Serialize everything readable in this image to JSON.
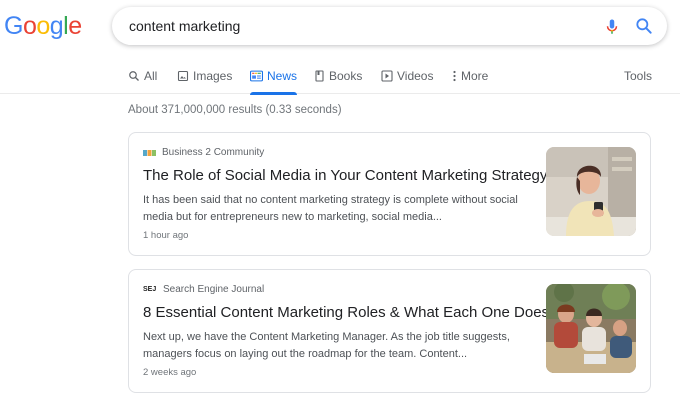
{
  "logo": {
    "letters": [
      "G",
      "o",
      "o",
      "g",
      "l",
      "e"
    ],
    "colors": [
      "#4285f4",
      "#ea4335",
      "#fbbc05",
      "#4285f4",
      "#34a853",
      "#ea4335"
    ]
  },
  "search": {
    "query": "content marketing",
    "mic_icon": "microphone-icon",
    "search_icon": "search-icon"
  },
  "tabs": [
    {
      "label": "All",
      "icon": "search-icon"
    },
    {
      "label": "Images",
      "icon": "image-icon"
    },
    {
      "label": "News",
      "icon": "news-icon",
      "active": true
    },
    {
      "label": "Books",
      "icon": "book-icon"
    },
    {
      "label": "Videos",
      "icon": "play-icon"
    },
    {
      "label": "More",
      "icon": "more-vert-icon"
    },
    {
      "label": "Tools"
    }
  ],
  "result_stats": "About 371,000,000 results (0.33 seconds)",
  "results": [
    {
      "source": "Business 2 Community",
      "title": "The Role of Social Media in Your Content Marketing Strategy",
      "snippet_line1": "It has been said that no content marketing strategy is complete without social",
      "snippet_line2": "media but for entrepreneurs new to marketing, social media...",
      "age": "1 hour ago"
    },
    {
      "source": "Search Engine Journal",
      "favicon_text": "SEJ",
      "title": "8 Essential Content Marketing Roles & What Each One Does",
      "snippet_line1": "Next up, we have the Content Marketing Manager. As the job title suggests,",
      "snippet_line2": "managers focus on laying out the roadmap for the team. Content...",
      "age": "2 weeks ago"
    }
  ],
  "colors": {
    "accent": "#1a73e8",
    "text_secondary": "#5f6368",
    "border": "#dfe1e5"
  }
}
